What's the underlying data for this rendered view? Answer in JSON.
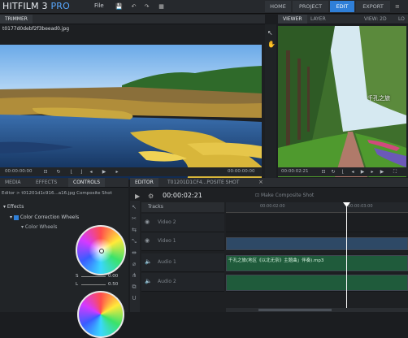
{
  "app": {
    "name": "HITFILM 3",
    "edition": "PRO",
    "menu_file": "File"
  },
  "nav": {
    "tabs": [
      "HOME",
      "PROJECT",
      "EDIT",
      "EXPORT"
    ],
    "active": "EDIT"
  },
  "trimmer": {
    "tab": "TRIMMER",
    "filename": "t0177d0debf2f3beead0.jpg",
    "timecode_left": "00:00:00:00",
    "timecode_right": "00:00:00:00"
  },
  "viewer": {
    "tabs": [
      "VIEWER",
      "LAYER"
    ],
    "view_label": "VIEW: 2D",
    "lo_label": "LO",
    "timecode": "00:00:02:21",
    "image_caption": "千孔之旅"
  },
  "left_panel": {
    "tabs": [
      "MEDIA",
      "EFFECTS",
      "CONTROLS"
    ],
    "active": "CONTROLS",
    "breadcrumb": "Editor > t01201d1c916...a16.jpg Composite Shot",
    "tree_effects": "Effects",
    "tree_color_correction": "Color Correction Wheels",
    "tree_color_wheels": "Color Wheels",
    "s_value": "0.00",
    "l_value": "0.50",
    "s_label": "S",
    "l_label": "L"
  },
  "editor": {
    "tabs": [
      "EDITOR",
      "T01201D1CF4...POSITE SHOT"
    ],
    "timecode": "00:00:02:21",
    "make_composite": "Make Composite Shot",
    "tracks_label": "Tracks",
    "ruler": [
      "00:00:02:00",
      "00:00:03:00"
    ],
    "tracks": [
      "Video 2",
      "Video 1",
      "Audio 1",
      "Audio 2"
    ],
    "clip_audio_text": "千孔之旅(地区《以北无奈》主题曲」伴奏).mp3"
  },
  "colors": {
    "accent": "#2f7fd8",
    "pro": "#58a8ff",
    "playhead": "#ffffff",
    "audio_clip": "#1f5b3b",
    "video_clip": "#2e4966"
  }
}
